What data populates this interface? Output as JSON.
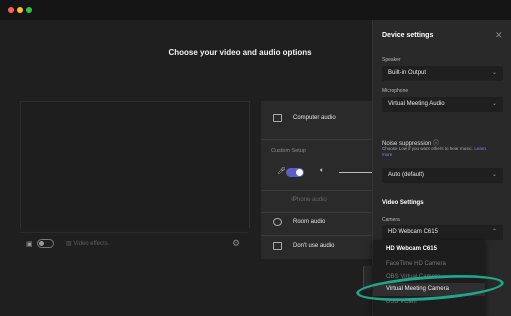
{
  "main": {
    "heading": "Choose your video and audio options"
  },
  "preview": {
    "effects_label": "Video effects"
  },
  "audio": {
    "computer_audio": "Computer audio",
    "custom_setup": "Custom Setup",
    "phone_audio": "Phone audio",
    "room_audio": "Room audio",
    "dont_use_audio": "Don't use audio"
  },
  "device_settings": {
    "title": "Device settings",
    "speaker_label": "Speaker",
    "speaker_value": "Built-in Output",
    "microphone_label": "Microphone",
    "microphone_value": "Virtual Meeting Audio",
    "noise_label": "Noise suppression",
    "noise_desc": "Choose Low if you want others to hear music.",
    "learn_more": "Learn more",
    "noise_value": "Auto (default)",
    "video_title": "Video Settings",
    "camera_label": "Camera",
    "camera_value": "HD Webcam C615",
    "camera_options": [
      "HD Webcam C615",
      "FaceTime HD Camera",
      "OBS Virtual Camera",
      "Virtual Meeting Camera",
      "USB VCam"
    ]
  },
  "colors": {
    "accent": "#5b5fc7",
    "highlight_ring": "#1fa58c",
    "mac_close": "#fe5f57",
    "mac_minimize": "#febc2e",
    "mac_zoom": "#28c840"
  }
}
